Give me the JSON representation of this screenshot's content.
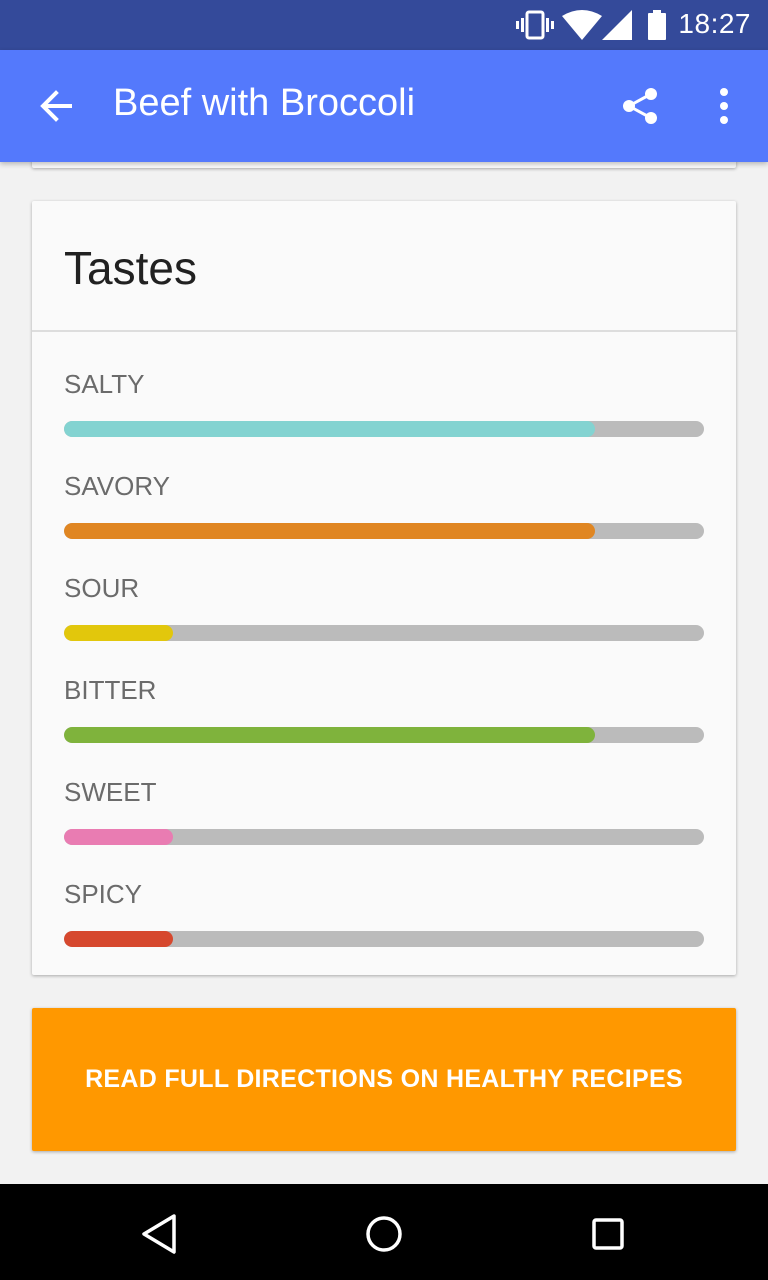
{
  "status_bar": {
    "time": "18:27",
    "icons": [
      "vibrate-icon",
      "wifi-icon",
      "signal-icon",
      "battery-icon"
    ]
  },
  "app_bar": {
    "title": "Beef with Broccoli",
    "icons": [
      "back-arrow-icon",
      "share-icon",
      "more-vert-icon"
    ],
    "color": "#5479fc"
  },
  "tastes_card": {
    "title": "Tastes",
    "items": [
      {
        "label": "SALTY",
        "level": 0.83,
        "color": "#83d3d1"
      },
      {
        "label": "SAVORY",
        "level": 0.83,
        "color": "#e08622"
      },
      {
        "label": "SOUR",
        "level": 0.17,
        "color": "#e2c70c"
      },
      {
        "label": "BITTER",
        "level": 0.83,
        "color": "#7fb33c"
      },
      {
        "label": "SWEET",
        "level": 0.17,
        "color": "#e97cb2"
      },
      {
        "label": "SPICY",
        "level": 0.17,
        "color": "#d6482e"
      }
    ]
  },
  "cta_button": {
    "label": "READ FULL DIRECTIONS ON HEALTHY RECIPES",
    "color": "#ff9800"
  },
  "nav_bar": {
    "icons": [
      "back-triangle-icon",
      "home-circle-icon",
      "recents-square-icon"
    ]
  }
}
